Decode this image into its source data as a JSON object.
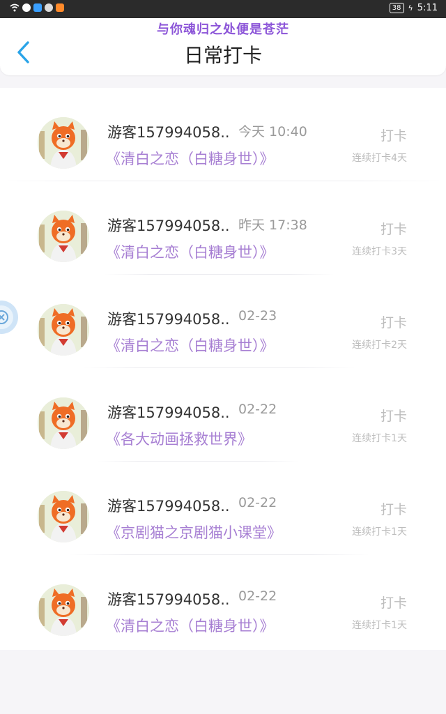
{
  "status_bar": {
    "time": "5:11",
    "battery": "38"
  },
  "header": {
    "banner": "与你魂归之处便是苍茫",
    "title": "日常打卡"
  },
  "records": [
    {
      "name": "游客157994058..",
      "time": "今天 10:40",
      "program": "《清白之恋（白糖身世）》",
      "action": "打卡",
      "streak": "连续打卡4天"
    },
    {
      "name": "游客157994058..",
      "time": "昨天 17:38",
      "program": "《清白之恋（白糖身世）》",
      "action": "打卡",
      "streak": "连续打卡3天"
    },
    {
      "name": "游客157994058..",
      "time": "02-23",
      "program": "《清白之恋（白糖身世）》",
      "action": "打卡",
      "streak": "连续打卡2天"
    },
    {
      "name": "游客157994058..",
      "time": "02-22",
      "program": "《各大动画拯救世界》",
      "action": "打卡",
      "streak": "连续打卡1天"
    },
    {
      "name": "游客157994058..",
      "time": "02-22",
      "program": "《京剧猫之京剧猫小课堂》",
      "action": "打卡",
      "streak": "连续打卡1天"
    },
    {
      "name": "游客157994058..",
      "time": "02-22",
      "program": "《清白之恋（白糖身世）》",
      "action": "打卡",
      "streak": "连续打卡1天"
    }
  ],
  "colors": {
    "accent": "#2aa4e8",
    "program_text": "#a77fd3",
    "banner_text": "#8c55d8"
  },
  "icons": {
    "back": "chevron-left-icon",
    "float": "close-circle-icon",
    "avatar": "cartoon-cat-avatar-icon"
  }
}
